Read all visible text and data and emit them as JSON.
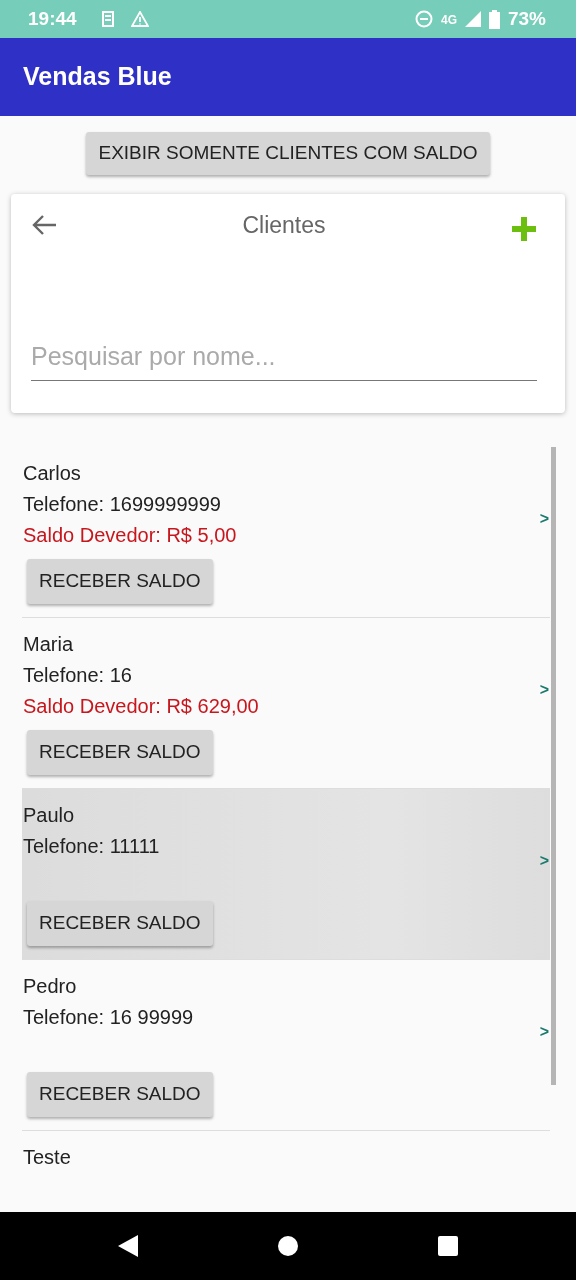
{
  "status_bar": {
    "time": "19:44",
    "network": "4G",
    "battery": "73%"
  },
  "app_bar": {
    "title": "Vendas Blue"
  },
  "filter_button": "EXIBIR SOMENTE CLIENTES COM SALDO",
  "search_card": {
    "title": "Clientes",
    "placeholder": "Pesquisar por nome..."
  },
  "clients": [
    {
      "name": "Carlos",
      "phone": "Telefone: 1699999999",
      "balance": "Saldo Devedor: R$ 5,00",
      "button": "RECEBER SALDO",
      "chevron": ">",
      "selected": false
    },
    {
      "name": "Maria",
      "phone": "Telefone: 16",
      "balance": "Saldo Devedor: R$ 629,00",
      "button": "RECEBER SALDO",
      "chevron": ">",
      "selected": false
    },
    {
      "name": "Paulo",
      "phone": "Telefone: 11111",
      "button": "RECEBER SALDO",
      "chevron": ">",
      "selected": true
    },
    {
      "name": "Pedro",
      "phone": "Telefone: 16 99999",
      "button": "RECEBER SALDO",
      "chevron": ">",
      "selected": false
    },
    {
      "name": "Teste",
      "selected": false
    }
  ]
}
